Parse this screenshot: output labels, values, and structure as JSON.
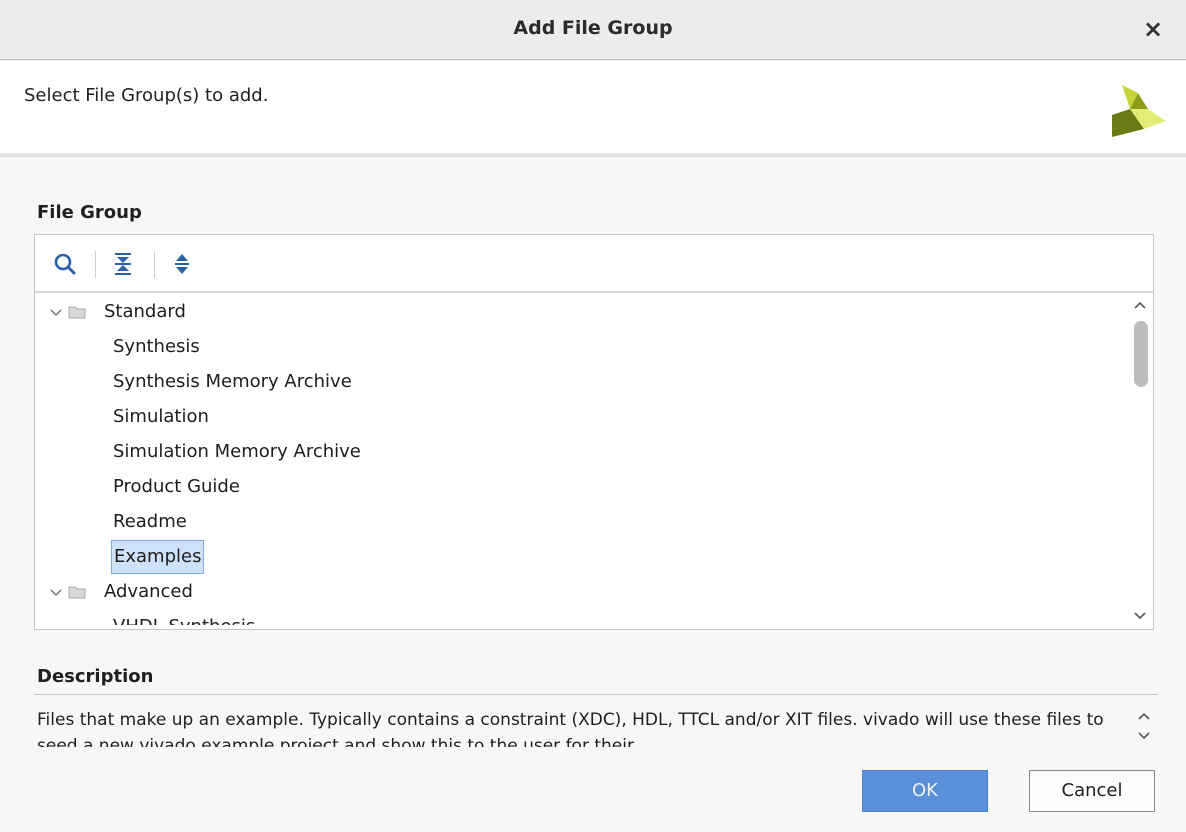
{
  "window": {
    "title": "Add File Group",
    "close_icon": "×"
  },
  "header": {
    "instruction": "Select File Group(s) to add.",
    "logo_icon": "vivado-logo-icon",
    "logo_colors": [
      "#8c9a1a",
      "#c6d23a",
      "#e5ec79",
      "#5b6a12"
    ]
  },
  "file_group": {
    "label": "File Group",
    "toolbar": {
      "search_icon": "search-icon",
      "collapse_all_icon": "collapse-all-icon",
      "expand_all_icon": "expand-all-icon"
    },
    "tree": {
      "standard": {
        "label": "Standard",
        "expanded": true,
        "children": [
          "Synthesis",
          "Synthesis Memory Archive",
          "Simulation",
          "Simulation Memory Archive",
          "Product Guide",
          "Readme",
          "Examples"
        ]
      },
      "advanced": {
        "label": "Advanced",
        "expanded": true,
        "children": [
          "VHDL Synthesis"
        ]
      },
      "selected": "Examples"
    }
  },
  "description": {
    "label": "Description",
    "text": "Files that make up an example. Typically contains a constraint (XDC), HDL, TTCL and/or XIT files. vivado will use these files to seed a new vivado example project and show this to the user for their"
  },
  "buttons": {
    "ok": "OK",
    "cancel": "Cancel"
  },
  "colors": {
    "accent": "#5a8fd9",
    "selection": "#cfe2fb"
  }
}
